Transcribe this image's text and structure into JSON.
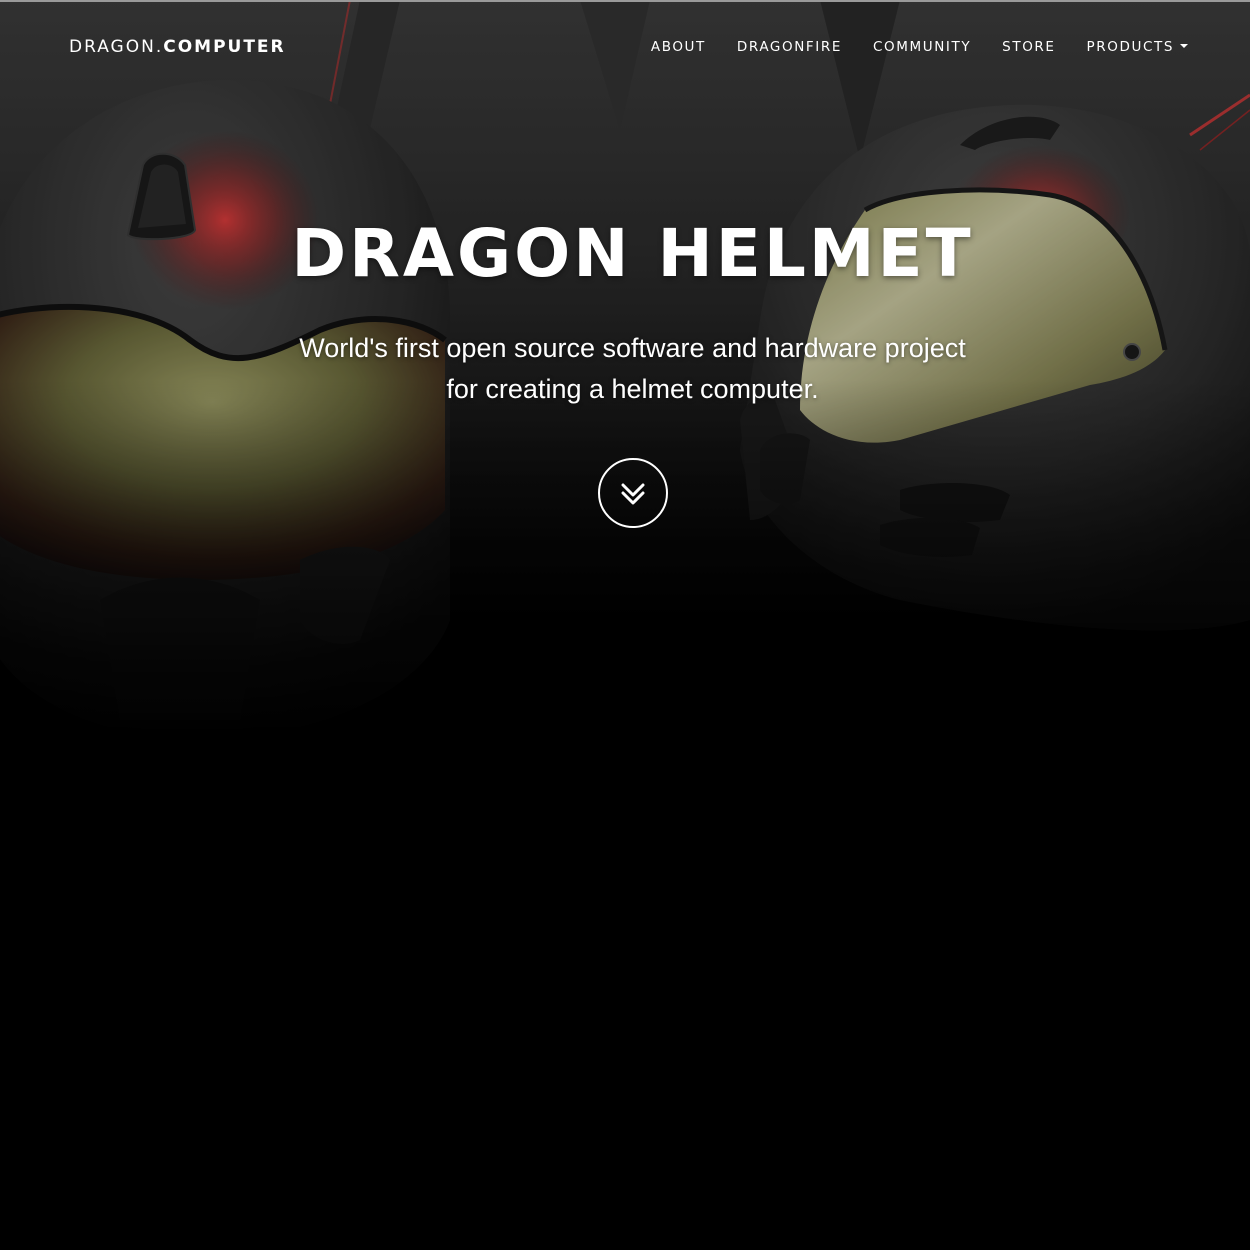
{
  "brand": {
    "name_thin": "DRAGON.",
    "name_bold": "COMPUTER"
  },
  "nav": {
    "items": [
      {
        "label": "ABOUT"
      },
      {
        "label": "DRAGONFIRE"
      },
      {
        "label": "COMMUNITY"
      },
      {
        "label": "STORE"
      },
      {
        "label": "PRODUCTS",
        "has_dropdown": true
      }
    ]
  },
  "hero": {
    "title": "DRAGON HELMET",
    "subtitle_line1": "World's first open source software and hardware project",
    "subtitle_line2": "for creating a helmet computer.",
    "scroll_icon": "double-chevron-down-icon"
  },
  "colors": {
    "background": "#000000",
    "text": "#ffffff",
    "accent_red": "#d83a3a",
    "visor_olive": "#9a9a5c"
  }
}
